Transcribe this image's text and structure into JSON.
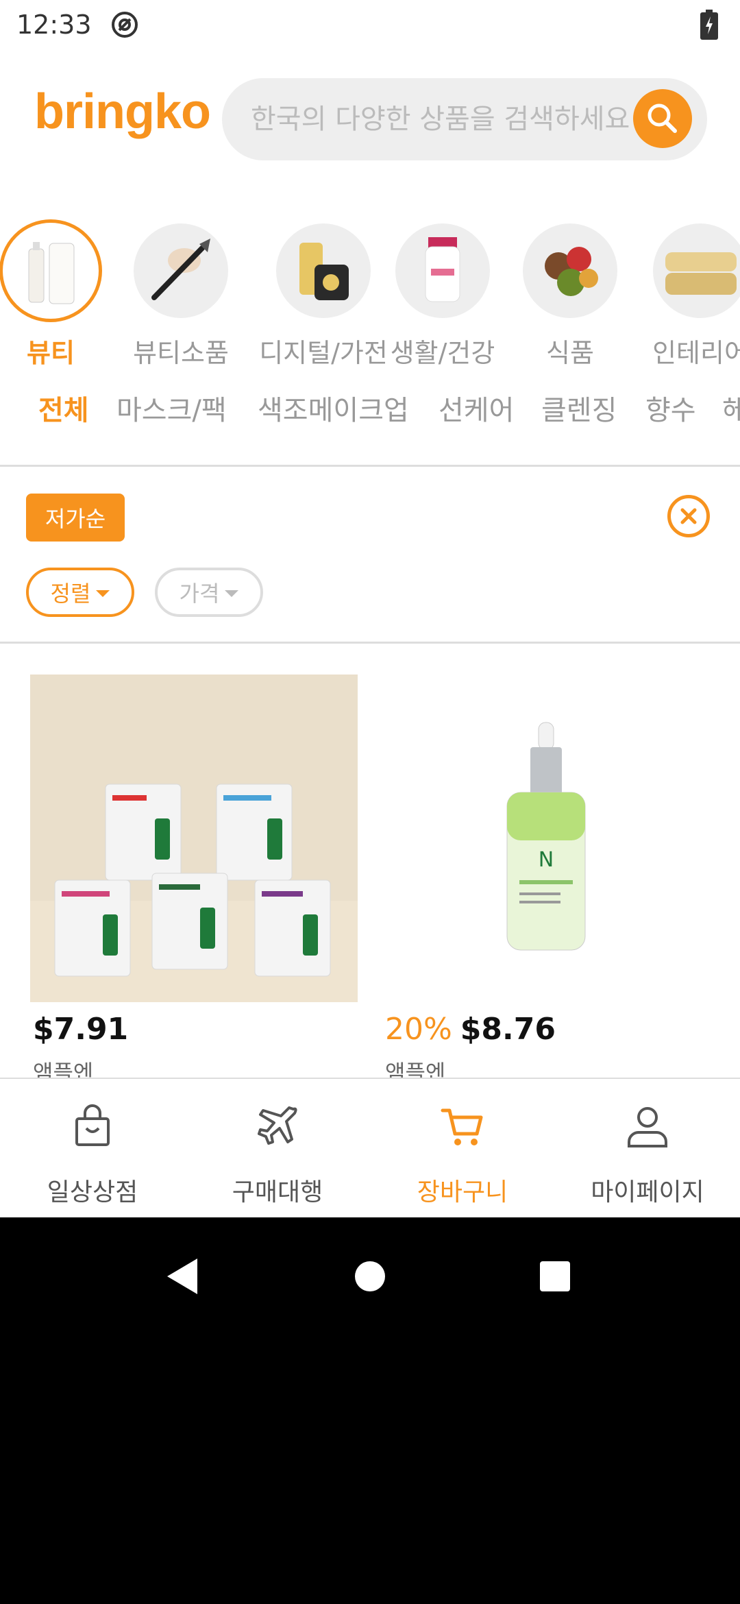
{
  "status_bar": {
    "time": "12:33"
  },
  "header": {
    "logo": "bringko",
    "search_placeholder": "한국의 다양한 상품을 검색하세요"
  },
  "categories": [
    {
      "label": "뷰티",
      "active": true
    },
    {
      "label": "뷰티소품"
    },
    {
      "label": "디지털/가전"
    },
    {
      "label": "생활/건강"
    },
    {
      "label": "식품"
    },
    {
      "label": "인테리어"
    }
  ],
  "subtabs": [
    "전체",
    "마스크/팩",
    "색조메이크업",
    "선케어",
    "클렌징",
    "향수",
    "헤"
  ],
  "filters": {
    "active_sort": "저가순",
    "sort_dropdown": "정렬",
    "price_dropdown": "가격"
  },
  "products": [
    {
      "price": "$7.91",
      "discount": "",
      "brand": "앰플엔"
    },
    {
      "price": "$8.76",
      "discount": "20%",
      "brand": "앰플엔"
    }
  ],
  "bottom_nav": [
    {
      "label": "일상상점",
      "icon": "shopping-bag-icon"
    },
    {
      "label": "구매대행",
      "icon": "airplane-icon"
    },
    {
      "label": "장바구니",
      "icon": "cart-icon",
      "active": true
    },
    {
      "label": "마이페이지",
      "icon": "user-icon"
    }
  ],
  "colors": {
    "accent": "#f7931e",
    "muted": "#999999"
  }
}
